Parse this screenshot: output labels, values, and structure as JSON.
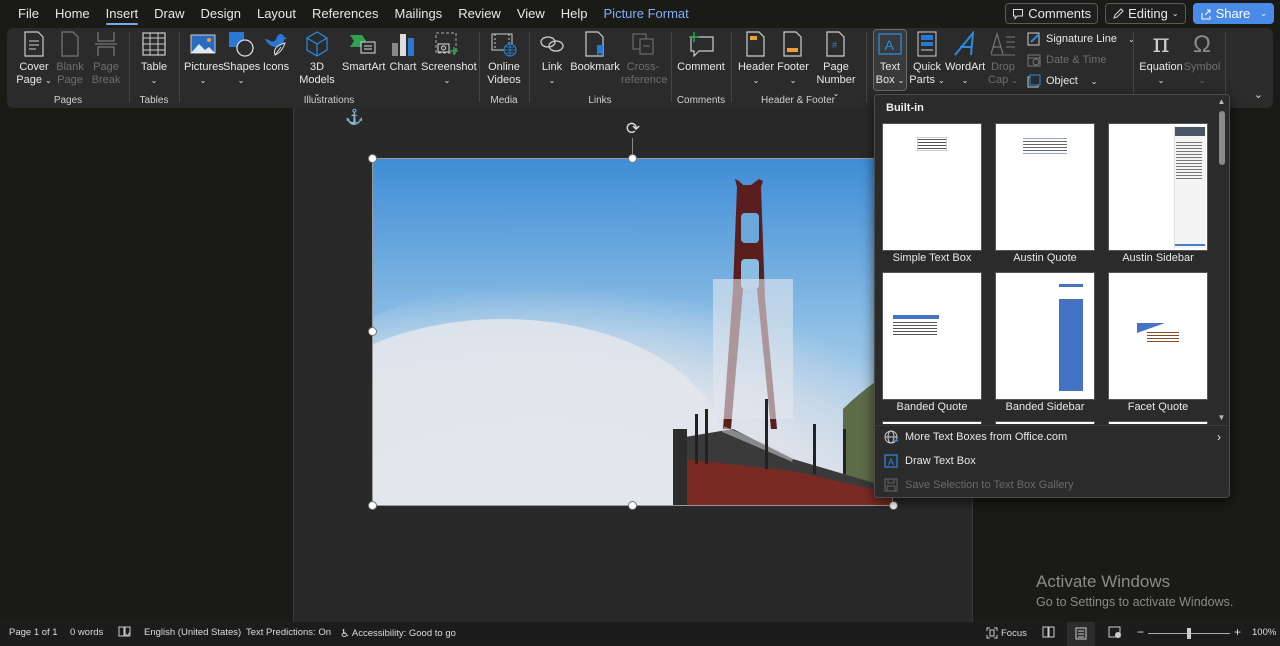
{
  "tabs": [
    {
      "label": "File"
    },
    {
      "label": "Home"
    },
    {
      "label": "Insert",
      "active": true
    },
    {
      "label": "Draw"
    },
    {
      "label": "Design"
    },
    {
      "label": "Layout"
    },
    {
      "label": "References"
    },
    {
      "label": "Mailings"
    },
    {
      "label": "Review"
    },
    {
      "label": "View"
    },
    {
      "label": "Help"
    },
    {
      "label": "Picture Format",
      "contextual": true
    }
  ],
  "top_right": {
    "comments_label": "Comments",
    "editing_label": "Editing",
    "share_label": "Share"
  },
  "ribbon": {
    "groups": {
      "pages": "Pages",
      "tables": "Tables",
      "illustrations": "Illustrations",
      "media": "Media",
      "links": "Links",
      "comments": "Comments",
      "header_footer": "Header & Footer"
    },
    "buttons": {
      "cover_page": [
        "Cover",
        "Page"
      ],
      "blank_page": [
        "Blank",
        "Page"
      ],
      "page_break": [
        "Page",
        "Break"
      ],
      "table": "Table",
      "pictures": "Pictures",
      "shapes": "Shapes",
      "icons": "Icons",
      "models_3d": [
        "3D",
        "Models"
      ],
      "smartart": "SmartArt",
      "chart": "Chart",
      "screenshot": "Screenshot",
      "online_videos": [
        "Online",
        "Videos"
      ],
      "link": "Link",
      "bookmark": "Bookmark",
      "cross_reference": [
        "Cross-",
        "reference"
      ],
      "comment": "Comment",
      "header": "Header",
      "footer": "Footer",
      "page_number": [
        "Page",
        "Number"
      ],
      "text_box": [
        "Text",
        "Box"
      ],
      "quick_parts": [
        "Quick",
        "Parts"
      ],
      "wordart": "WordArt",
      "drop_cap": [
        "Drop",
        "Cap"
      ],
      "signature_line": "Signature Line",
      "date_time": "Date & Time",
      "object": "Object",
      "equation": "Equation",
      "symbol": "Symbol"
    }
  },
  "text_box_menu": {
    "heading": "Built-in",
    "gallery": [
      {
        "label": "Simple Text Box"
      },
      {
        "label": "Austin Quote"
      },
      {
        "label": "Austin Sidebar"
      },
      {
        "label": "Banded Quote"
      },
      {
        "label": "Banded Sidebar"
      },
      {
        "label": "Facet Quote"
      }
    ],
    "items": [
      {
        "label": "More Text Boxes from Office.com",
        "icon": "globe-icon",
        "enabled": true,
        "submenu": true
      },
      {
        "label": "Draw Text Box",
        "icon": "text-box-icon",
        "enabled": true
      },
      {
        "label": "Save Selection to Text Box Gallery",
        "icon": "save-icon",
        "enabled": false
      }
    ]
  },
  "status_bar": {
    "page": "Page 1 of 1",
    "words": "0 words",
    "language": "English (United States)",
    "text_predictions": "Text Predictions: On",
    "accessibility": "Accessibility: Good to go",
    "focus": "Focus",
    "zoom_level": "100%",
    "zoom_minus": "−",
    "zoom_plus": "+",
    "zoom_fraction": 0.5
  },
  "watermark": {
    "title": "Activate Windows",
    "subtitle": "Go to Settings to activate Windows."
  },
  "colors": {
    "accent": "#4a8ae8",
    "contextual_tab": "#84aef5",
    "ribbon_bg": "#2b2b2b",
    "page_bg": "#292929"
  }
}
